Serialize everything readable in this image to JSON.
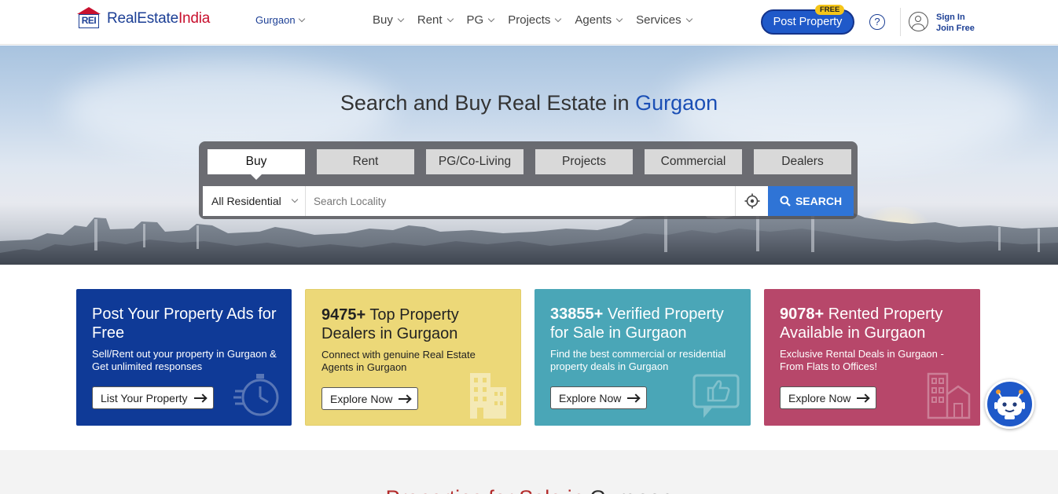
{
  "header": {
    "logo_mark": "REI",
    "logo_name_part1": "RealEstate",
    "logo_name_part2": "India",
    "city": "Gurgaon",
    "nav": [
      {
        "label": "Buy"
      },
      {
        "label": "Rent"
      },
      {
        "label": "PG"
      },
      {
        "label": "Projects"
      },
      {
        "label": "Agents"
      },
      {
        "label": "Services"
      }
    ],
    "post_property_label": "Post Property",
    "free_badge": "FREE",
    "help_glyph": "?",
    "sign_in": "Sign In",
    "join_free": "Join Free"
  },
  "hero": {
    "title_prefix": "Search and Buy Real Estate in",
    "title_city": "Gurgaon",
    "tabs": [
      {
        "label": "Buy",
        "active": true
      },
      {
        "label": "Rent",
        "active": false
      },
      {
        "label": "PG/Co-Living",
        "active": false
      },
      {
        "label": "Projects",
        "active": false
      },
      {
        "label": "Commercial",
        "active": false
      },
      {
        "label": "Dealers",
        "active": false
      }
    ],
    "property_type": "All Residential",
    "search_placeholder": "Search Locality",
    "search_button": "SEARCH"
  },
  "cards": [
    {
      "title_bold": "",
      "title_rest": "Post Your Property Ads for Free",
      "desc": "Sell/Rent out your property in Gurgaon & Get unlimited responses",
      "cta": "List Your Property",
      "icon": "stopwatch-icon"
    },
    {
      "title_bold": "9475+",
      "title_rest": " Top Property Dealers in Gurgaon",
      "desc": "Connect with genuine Real Estate Agents in Gurgaon",
      "cta": "Explore Now",
      "icon": "building-icon"
    },
    {
      "title_bold": "33855+",
      "title_rest": " Verified Property for Sale in Gurgaon",
      "desc": "Find the best commercial or residential property deals in Gurgaon",
      "cta": "Explore Now",
      "icon": "thumbs-up-icon"
    },
    {
      "title_bold": "9078+",
      "title_rest": " Rented Property Available in Gurgaon",
      "desc": "Exclusive Rental Deals in Gurgaon - From Flats to Offices!",
      "cta": "Explore Now",
      "icon": "apartment-icon"
    }
  ],
  "section": {
    "title_part1": "Properties for Sale in",
    "title_part2": "Gurgaon"
  },
  "colors": {
    "brand_blue": "#1c3f95",
    "brand_red": "#c8102e",
    "search_blue": "#2f74d6",
    "card1": "#0f3a97",
    "card2": "#ecd878",
    "card3": "#4aa6b7",
    "card4": "#b7476a"
  }
}
